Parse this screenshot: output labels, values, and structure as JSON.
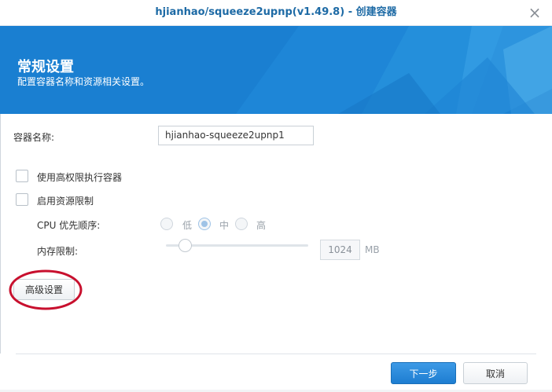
{
  "window": {
    "title": "hjianhao/squeeze2upnp(v1.49.8) - 创建容器",
    "close_icon": "close-icon"
  },
  "header": {
    "title": "常规设置",
    "subtitle": "配置容器名称和资源相关设置。"
  },
  "form": {
    "container_name_label": "容器名称:",
    "container_name_value": "hjianhao-squeeze2upnp1",
    "privileged_label": "使用高权限执行容器",
    "privileged_checked": false,
    "resource_limit_label": "启用资源限制",
    "resource_limit_checked": false,
    "cpu_priority_label": "CPU 优先顺序:",
    "cpu_options": [
      "低",
      "中",
      "高"
    ],
    "cpu_selected": "中",
    "memory_label": "内存限制:",
    "memory_value": "1024",
    "memory_unit": "MB"
  },
  "buttons": {
    "advanced": "高级设置",
    "next": "下一步",
    "cancel": "取消"
  },
  "colors": {
    "accent": "#1a7fd1",
    "title_text": "#1d6aa5",
    "annotation": "#c8102e"
  }
}
